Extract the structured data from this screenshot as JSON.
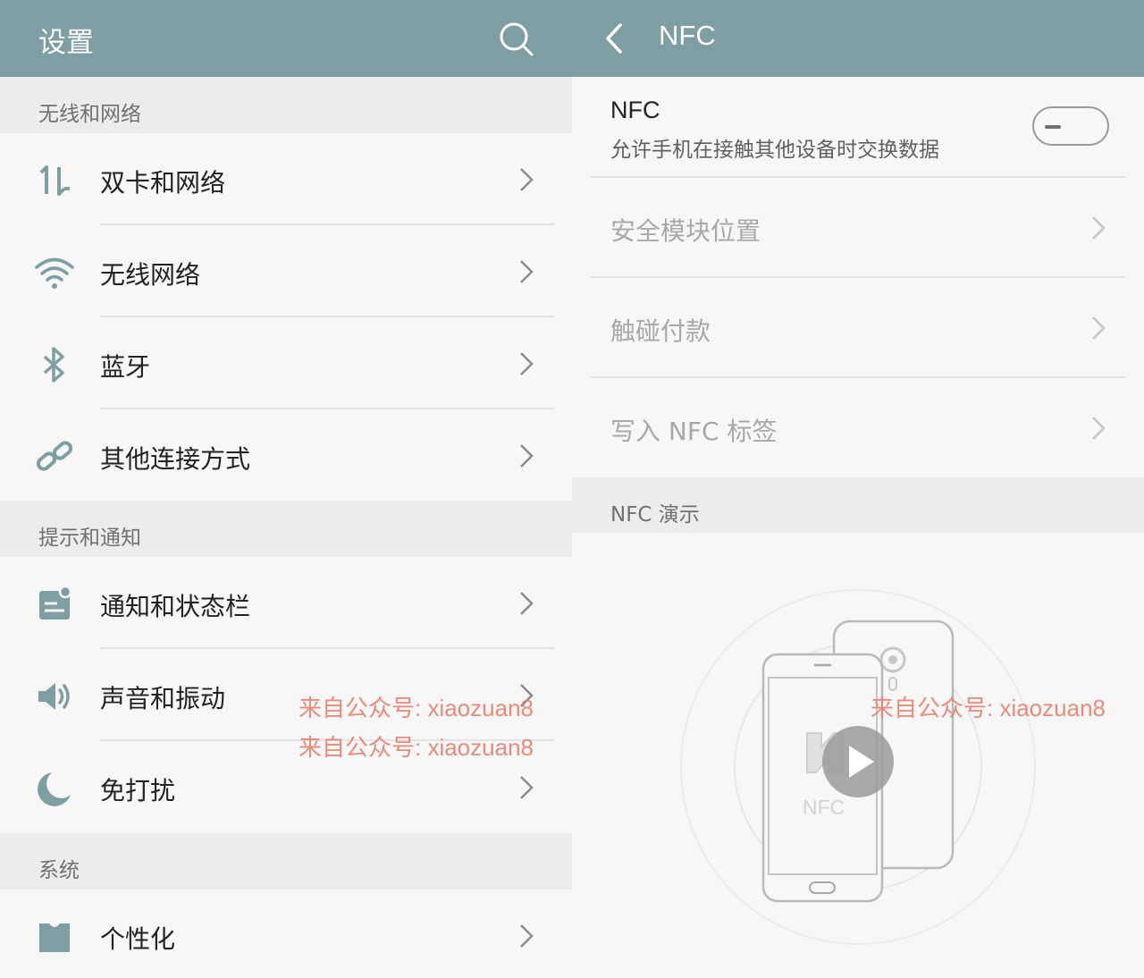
{
  "left": {
    "title": "设置",
    "sections": [
      {
        "header": "无线和网络",
        "items": [
          "双卡和网络",
          "无线网络",
          "蓝牙",
          "其他连接方式"
        ]
      },
      {
        "header": "提示和通知",
        "items": [
          "通知和状态栏",
          "声音和振动",
          "免打扰"
        ]
      },
      {
        "header": "系统",
        "items": [
          "个性化"
        ]
      }
    ],
    "icons": [
      "dual-sim-icon",
      "wifi-icon",
      "bluetooth-icon",
      "link-icon",
      "notification-icon",
      "speaker-icon",
      "moon-icon",
      "personalize-icon"
    ]
  },
  "right": {
    "title": "NFC",
    "nfc_toggle": {
      "title": "NFC",
      "description": "允许手机在接触其他设备时交换数据",
      "enabled": false
    },
    "items": [
      "安全模块位置",
      "触碰付款",
      "写入 NFC 标签"
    ],
    "demo_header": "NFC 演示",
    "demo_label": "NFC"
  },
  "watermark": "来自公众号: xiaozuan8",
  "colors": {
    "appbar": "#7d9ea2",
    "icon": "#7d9ea2",
    "watermark": "#e8806f"
  }
}
